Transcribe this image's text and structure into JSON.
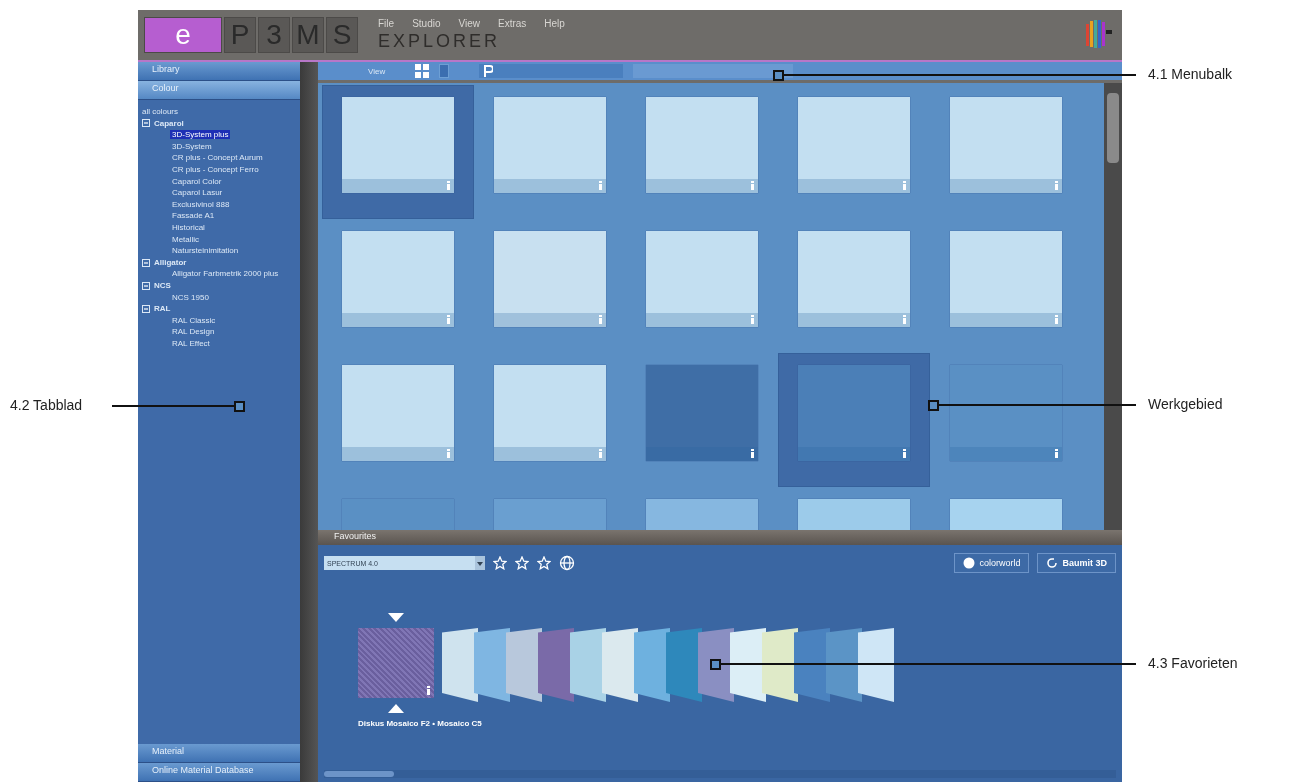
{
  "header": {
    "logo_letters": [
      "e",
      "P",
      "3",
      "M",
      "S"
    ],
    "menu": [
      "File",
      "Studio",
      "View",
      "Extras",
      "Help"
    ],
    "title": "EXPLORER"
  },
  "sidebar": {
    "top_tabs": [
      {
        "label": "Library",
        "selected": false
      },
      {
        "label": "Colour",
        "selected": true
      }
    ],
    "tree": [
      {
        "label": "all colours",
        "children": [
          {
            "label": "Caparol",
            "expanded": true,
            "children": [
              {
                "label": "3D-System plus",
                "selected": true
              },
              {
                "label": "3D-System",
                "selected": false
              },
              {
                "label": "CR plus - Concept Aurum",
                "selected": false
              },
              {
                "label": "CR plus - Concept Ferro",
                "selected": false
              },
              {
                "label": "Caparol Color",
                "selected": false
              },
              {
                "label": "Caparol Lasur",
                "selected": false
              },
              {
                "label": "Exclusivinol 888",
                "selected": false
              },
              {
                "label": "Fassade A1",
                "selected": false
              },
              {
                "label": "Historical",
                "selected": false
              },
              {
                "label": "Metallic",
                "selected": false
              },
              {
                "label": "Natursteinimitation",
                "selected": false
              }
            ]
          },
          {
            "label": "Alligator",
            "expanded": true,
            "children": [
              {
                "label": "Alligator Farbmetrik 2000 plus",
                "selected": false
              }
            ]
          },
          {
            "label": "NCS",
            "expanded": true,
            "children": [
              {
                "label": "NCS 1950",
                "selected": false
              }
            ]
          },
          {
            "label": "RAL",
            "expanded": true,
            "children": [
              {
                "label": "RAL Classic",
                "selected": false
              },
              {
                "label": "RAL Design",
                "selected": false
              },
              {
                "label": "RAL Effect",
                "selected": false
              }
            ]
          }
        ]
      }
    ],
    "bottom_tabs": [
      {
        "label": "Material",
        "selected": false
      },
      {
        "label": "Online Material Database",
        "selected": false
      }
    ]
  },
  "toolbar": {
    "view_label": "View"
  },
  "tiles": [
    {
      "color": "#c3dff1",
      "selected": true
    },
    {
      "color": "#c3dff1",
      "selected": false
    },
    {
      "color": "#c3dff1",
      "selected": false
    },
    {
      "color": "#c3dff1",
      "selected": false
    },
    {
      "color": "#c3dff1",
      "selected": false
    },
    {
      "color": "#c3dff1",
      "selected": false
    },
    {
      "color": "#c8e0f0",
      "selected": false
    },
    {
      "color": "#c3dff1",
      "selected": false
    },
    {
      "color": "#c3dff1",
      "selected": false
    },
    {
      "color": "#c3dff1",
      "selected": false
    },
    {
      "color": "#c3dff1",
      "selected": false
    },
    {
      "color": "#c3dff1",
      "selected": false
    },
    {
      "color": "#3f6ea6",
      "selected": false
    },
    {
      "color": "#4b7fb7",
      "selected": true
    },
    {
      "color": "#5a90c4",
      "selected": false
    },
    {
      "color": "#5a90c4",
      "selected": false
    },
    {
      "color": "#6a9fd0",
      "selected": false
    },
    {
      "color": "#86b7e0",
      "selected": false
    },
    {
      "color": "#9ccbea",
      "selected": false
    },
    {
      "color": "#a7d3ef",
      "selected": false
    }
  ],
  "favourites": {
    "title": "Favourites",
    "collection": "SPECTRUM 4.0",
    "colorworld_label": "colorworld",
    "viewer_label": "Baumit 3D",
    "current_caption": "Diskus Mosaico F2 • Mosaico C5",
    "swatches": [
      {
        "color": "#cfe3ee"
      },
      {
        "color": "#7fb6e2"
      },
      {
        "color": "#b8c8dc"
      },
      {
        "color": "#7a6aa8"
      },
      {
        "color": "#a9d2e6"
      },
      {
        "color": "#dbe9ee"
      },
      {
        "color": "#6eb1df"
      },
      {
        "color": "#2e88bb"
      },
      {
        "color": "#8a8fc2"
      },
      {
        "color": "#dceef6"
      },
      {
        "color": "#dfeac8"
      },
      {
        "color": "#4a82bf"
      },
      {
        "color": "#5b94c6"
      },
      {
        "color": "#cfe6f6"
      }
    ]
  },
  "callouts": [
    {
      "label": "4.1 Menubalk"
    },
    {
      "label": "4.2 Tabblad"
    },
    {
      "label": "Werkgebied"
    },
    {
      "label": "4.3 Favorieten"
    }
  ]
}
